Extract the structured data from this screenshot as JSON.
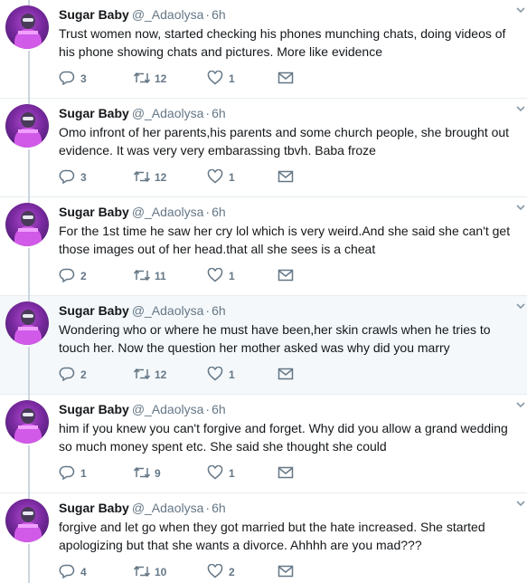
{
  "colors": {
    "accent": "#1da1f2",
    "muted": "#657786",
    "thread": "#ccd6dd",
    "highlight_bg": "#f5f8fa"
  },
  "icons": {
    "reply": "reply-icon",
    "retweet": "retweet-icon",
    "like": "heart-icon",
    "dm": "envelope-icon",
    "menu": "chevron-down-icon"
  },
  "tweets": [
    {
      "name": "Sugar Baby",
      "handle": "@_Adaolysa",
      "time": "6h",
      "text": "Trust women now, started checking his phones munching chats, doing videos of his phone showing chats and pictures. More like evidence",
      "replies": "3",
      "retweets": "12",
      "likes": "1"
    },
    {
      "name": "Sugar Baby",
      "handle": "@_Adaolysa",
      "time": "6h",
      "text": "Omo infront of her parents,his parents and some church people, she brought out evidence. It was very very embarassing tbvh. Baba froze",
      "replies": "3",
      "retweets": "12",
      "likes": "1"
    },
    {
      "name": "Sugar Baby",
      "handle": "@_Adaolysa",
      "time": "6h",
      "text": "For the 1st time he saw her cry lol which is very weird.And she said she can't get those images out of her head.that all she sees is a cheat",
      "replies": "2",
      "retweets": "11",
      "likes": "1"
    },
    {
      "name": "Sugar Baby",
      "handle": "@_Adaolysa",
      "time": "6h",
      "text": "Wondering who or where he must have been,her skin crawls when he tries to touch her. Now the question her mother asked was why did you marry",
      "replies": "2",
      "retweets": "12",
      "likes": "1"
    },
    {
      "name": "Sugar Baby",
      "handle": "@_Adaolysa",
      "time": "6h",
      "text": "him if you knew you can't forgive and forget. Why did you allow a grand wedding so much money spent etc. She said she thought she could",
      "replies": "1",
      "retweets": "9",
      "likes": "1"
    },
    {
      "name": "Sugar Baby",
      "handle": "@_Adaolysa",
      "time": "6h",
      "text": "forgive and let go when they got married but the hate increased. She started apologizing but that she wants a divorce. Ahhhh are you mad???",
      "replies": "4",
      "retweets": "10",
      "likes": "2"
    }
  ]
}
